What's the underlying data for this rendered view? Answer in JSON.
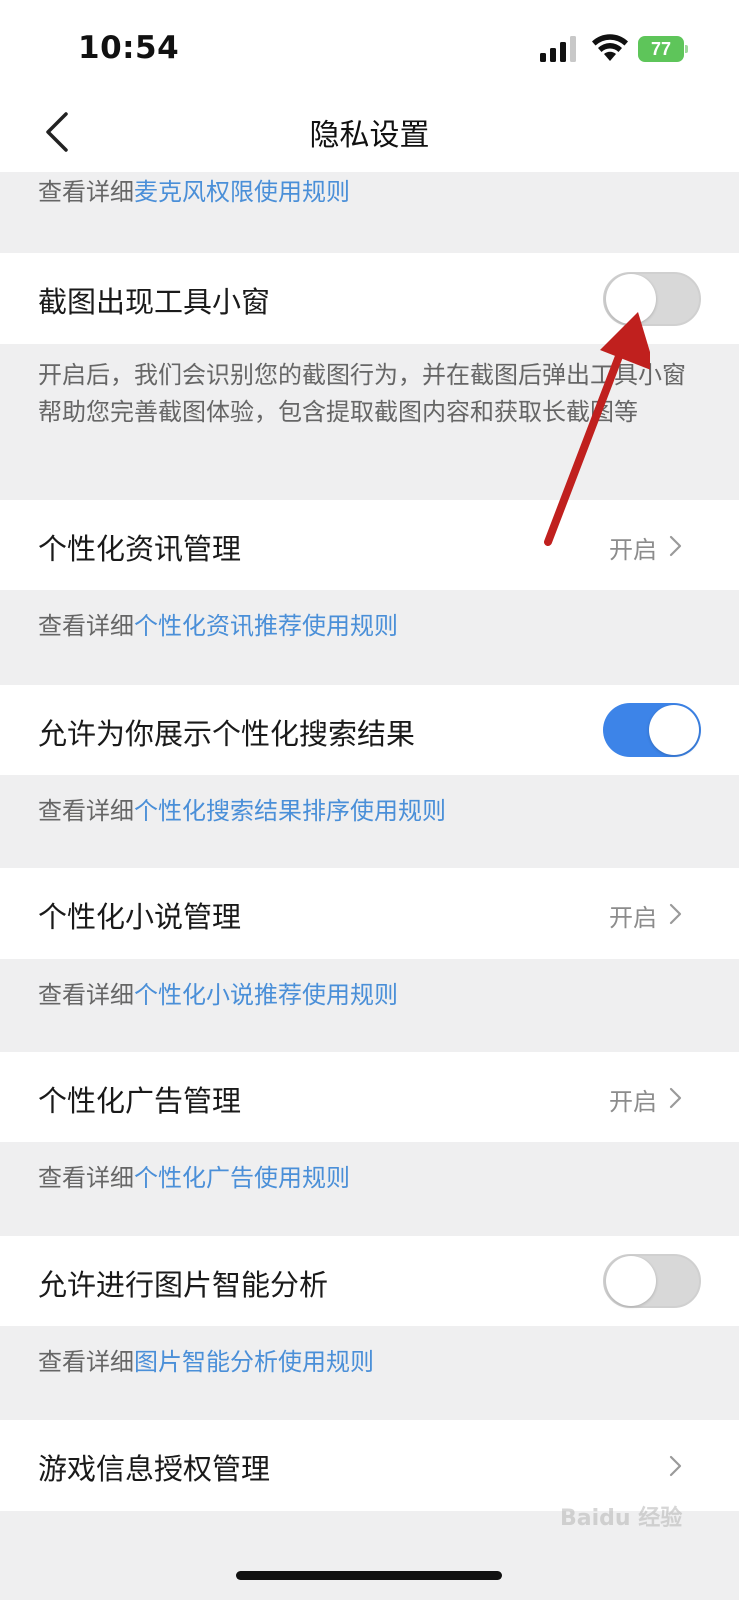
{
  "status_bar": {
    "time": "10:54",
    "battery": "77"
  },
  "nav": {
    "title": "隐私设置"
  },
  "rows": {
    "mic_desc": {
      "prefix": "查看详细",
      "link": "麦克风权限使用规则"
    },
    "screenshot_tool": {
      "label": "截图出现工具小窗",
      "toggle": "off",
      "desc": "开启后，我们会识别您的截图行为，并在截图后弹出工具小窗帮助您完善截图体验，包含提取截图内容和获取长截图等"
    },
    "personal_news": {
      "label": "个性化资讯管理",
      "value": "开启",
      "desc_prefix": "查看详细",
      "desc_link": "个性化资讯推荐使用规则"
    },
    "personal_search": {
      "label": "允许为你展示个性化搜索结果",
      "toggle": "on",
      "desc_prefix": "查看详细",
      "desc_link": "个性化搜索结果排序使用规则"
    },
    "personal_novel": {
      "label": "个性化小说管理",
      "value": "开启",
      "desc_prefix": "查看详细",
      "desc_link": "个性化小说推荐使用规则"
    },
    "personal_ads": {
      "label": "个性化广告管理",
      "value": "开启",
      "desc_prefix": "查看详细",
      "desc_link": "个性化广告使用规则"
    },
    "image_analysis": {
      "label": "允许进行图片智能分析",
      "toggle": "off",
      "desc_prefix": "查看详细",
      "desc_link": "图片智能分析使用规则"
    },
    "game_info": {
      "label": "游戏信息授权管理"
    }
  },
  "watermark": "Baidu 经验",
  "colors": {
    "link": "#4a8fd8",
    "toggle_on": "#3d84e8",
    "annotation_arrow": "#c0201e"
  }
}
